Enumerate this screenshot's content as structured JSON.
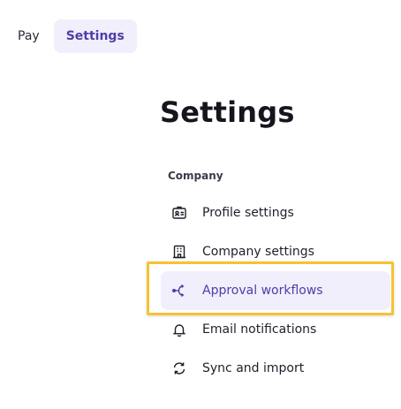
{
  "topnav": {
    "tabs": [
      {
        "label": "Pay"
      },
      {
        "label": "Settings"
      }
    ]
  },
  "page": {
    "title": "Settings"
  },
  "sidebar": {
    "section": "Company",
    "items": [
      {
        "label": "Profile settings",
        "icon": "id-card-icon"
      },
      {
        "label": "Company settings",
        "icon": "building-icon"
      },
      {
        "label": "Approval workflows",
        "icon": "workflow-branch-icon",
        "selected": true
      },
      {
        "label": "Email notifications",
        "icon": "bell-icon"
      },
      {
        "label": "Sync and import",
        "icon": "sync-icon"
      }
    ]
  },
  "colors": {
    "accent": "#4b3fa6",
    "selected_bg": "#f1effc",
    "highlight_border": "#f5c232"
  }
}
